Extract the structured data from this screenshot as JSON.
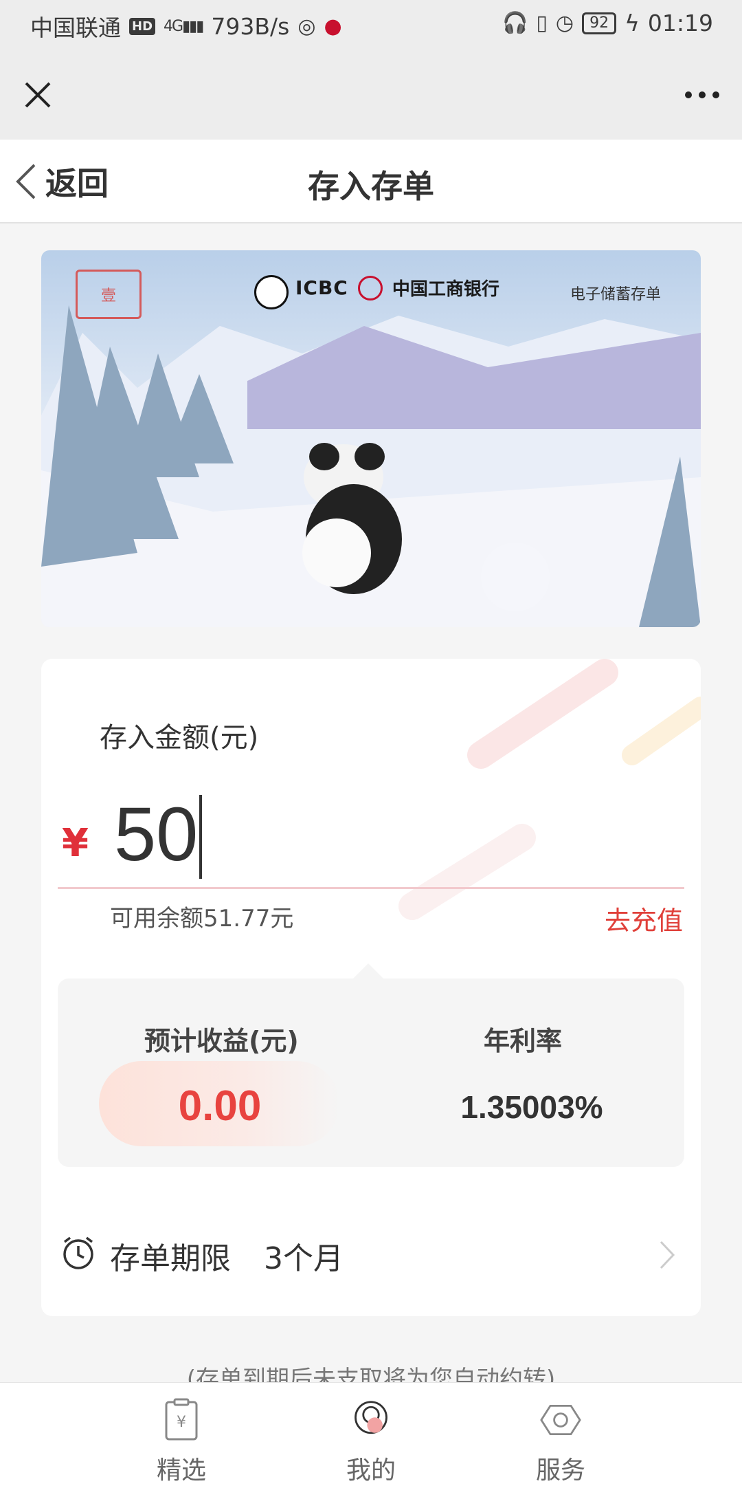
{
  "status_bar": {
    "carrier": "中国联通",
    "hd_badge": "HD",
    "network": "4G",
    "speed": "793B/s",
    "battery": "92",
    "time": "01:19"
  },
  "wechat_bar": {
    "close_icon": "close-icon",
    "more_icon": "more-icon"
  },
  "nav": {
    "back_label": "返回",
    "title": "存入存单"
  },
  "card_image": {
    "bank_name": "中国工商银行",
    "bank_abbr": "ICBC",
    "product_tag": "电子储蓄存单",
    "seal_text": "壹",
    "description_icon": "panda-illustration"
  },
  "deposit": {
    "label": "存入金额(元)",
    "currency_symbol": "¥",
    "amount_value": "50",
    "balance_text": "可用余额51.77元",
    "recharge_label": "去充值"
  },
  "profit": {
    "expected_label": "预计收益(元)",
    "expected_value": "0.00",
    "rate_label": "年利率",
    "rate_value": "1.35003%"
  },
  "term": {
    "label": "存单期限",
    "value": "3个月"
  },
  "auto_note": "(存单到期后未支取将为您自动约转)",
  "tabs": [
    {
      "label": "精选",
      "icon": "receipt-yen-icon"
    },
    {
      "label": "我的",
      "icon": "profile-avatar-icon"
    },
    {
      "label": "服务",
      "icon": "hexagon-service-icon"
    }
  ],
  "colors": {
    "accent_red": "#e8433f",
    "recharge_red": "#e0403a",
    "background": "#f5f5f5"
  }
}
